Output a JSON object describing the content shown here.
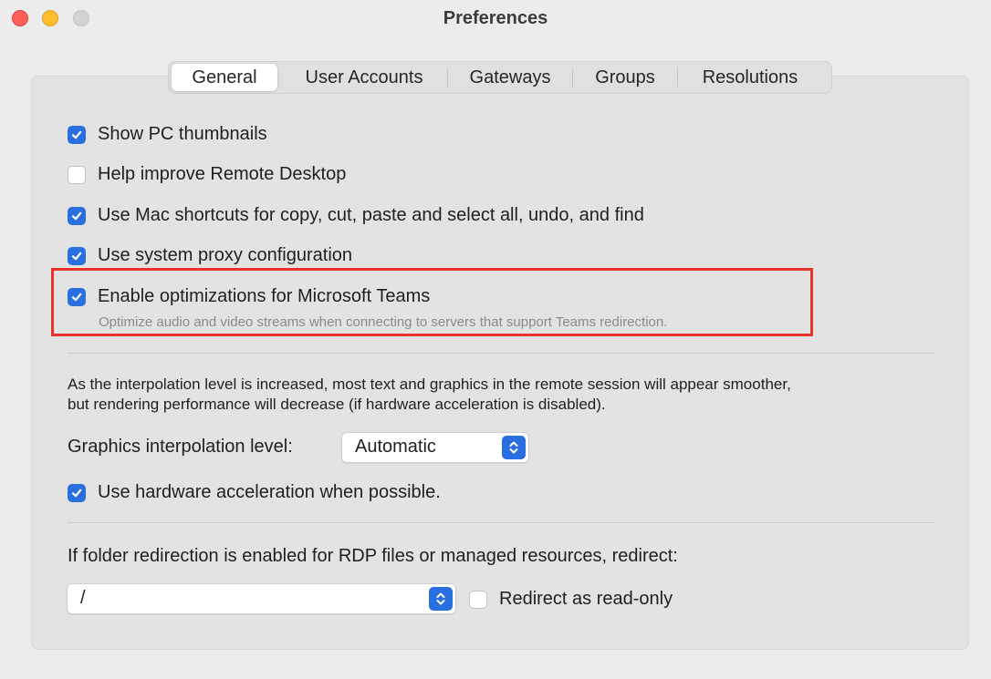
{
  "window": {
    "title": "Preferences"
  },
  "tabs": [
    {
      "label": "General",
      "active": true
    },
    {
      "label": "User Accounts",
      "active": false
    },
    {
      "label": "Gateways",
      "active": false
    },
    {
      "label": "Groups",
      "active": false
    },
    {
      "label": "Resolutions",
      "active": false
    }
  ],
  "options": {
    "show_thumbnails": {
      "label": "Show PC thumbnails",
      "checked": true
    },
    "help_improve": {
      "label": "Help improve Remote Desktop",
      "checked": false
    },
    "mac_shortcuts": {
      "label": "Use Mac shortcuts for copy, cut, paste and select all, undo, and find",
      "checked": true
    },
    "system_proxy": {
      "label": "Use system proxy configuration",
      "checked": true
    },
    "teams_optimizations": {
      "label": "Enable optimizations for Microsoft Teams",
      "checked": true,
      "description": "Optimize audio and video streams when connecting to servers that support Teams redirection."
    }
  },
  "graphics": {
    "info_line1": "As the interpolation level is increased, most text and graphics in the remote session will appear smoother,",
    "info_line2": "but rendering performance will decrease (if hardware acceleration is disabled).",
    "interpolation_label": "Graphics interpolation level:",
    "interpolation_value": "Automatic",
    "hw_accel": {
      "label": "Use hardware acceleration when possible.",
      "checked": true
    }
  },
  "folder_redirection": {
    "label": "If folder redirection is enabled for RDP files or managed resources, redirect:",
    "path_value": "/",
    "read_only": {
      "label": "Redirect as read-only",
      "checked": false
    }
  },
  "colors": {
    "accent": "#2a6fe0",
    "highlight_border": "#e8322a"
  }
}
